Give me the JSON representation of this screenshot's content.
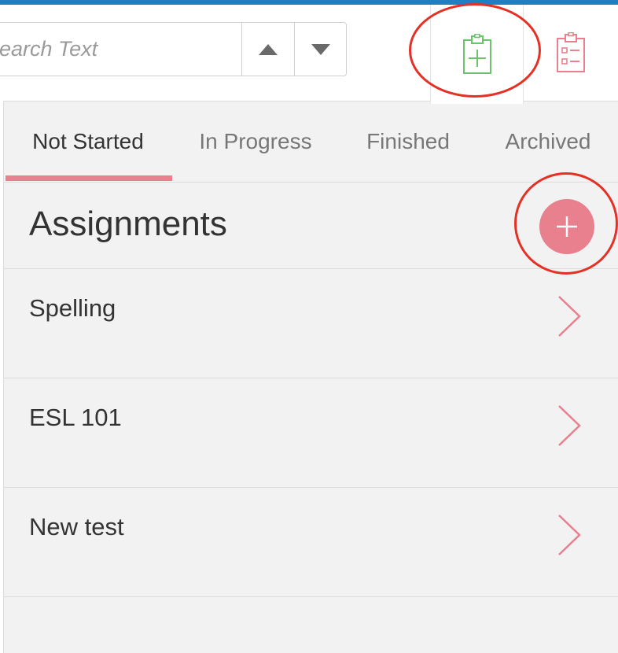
{
  "search": {
    "placeholder": "Search Text",
    "up_icon": "triangle-up-icon",
    "down_icon": "triangle-down-icon"
  },
  "toolbar": {
    "new_assignment_icon": "clipboard-plus-icon",
    "assignment_list_icon": "clipboard-list-icon",
    "new_assignment_color": "#6cc36c",
    "assignment_list_color": "#e8808e"
  },
  "tabs": [
    {
      "label": "Not Started",
      "active": true
    },
    {
      "label": "In Progress",
      "active": false
    },
    {
      "label": "Finished",
      "active": false
    },
    {
      "label": "Archived",
      "active": false
    }
  ],
  "section": {
    "title": "Assignments",
    "add_icon": "plus-icon"
  },
  "assignments": [
    {
      "name": "Spelling"
    },
    {
      "name": "ESL 101"
    },
    {
      "name": "New test"
    }
  ],
  "colors": {
    "accent": "#e8808e",
    "top_bar": "#1f7fc4",
    "annotation": "#e53125",
    "background": "#f2f2f2"
  }
}
